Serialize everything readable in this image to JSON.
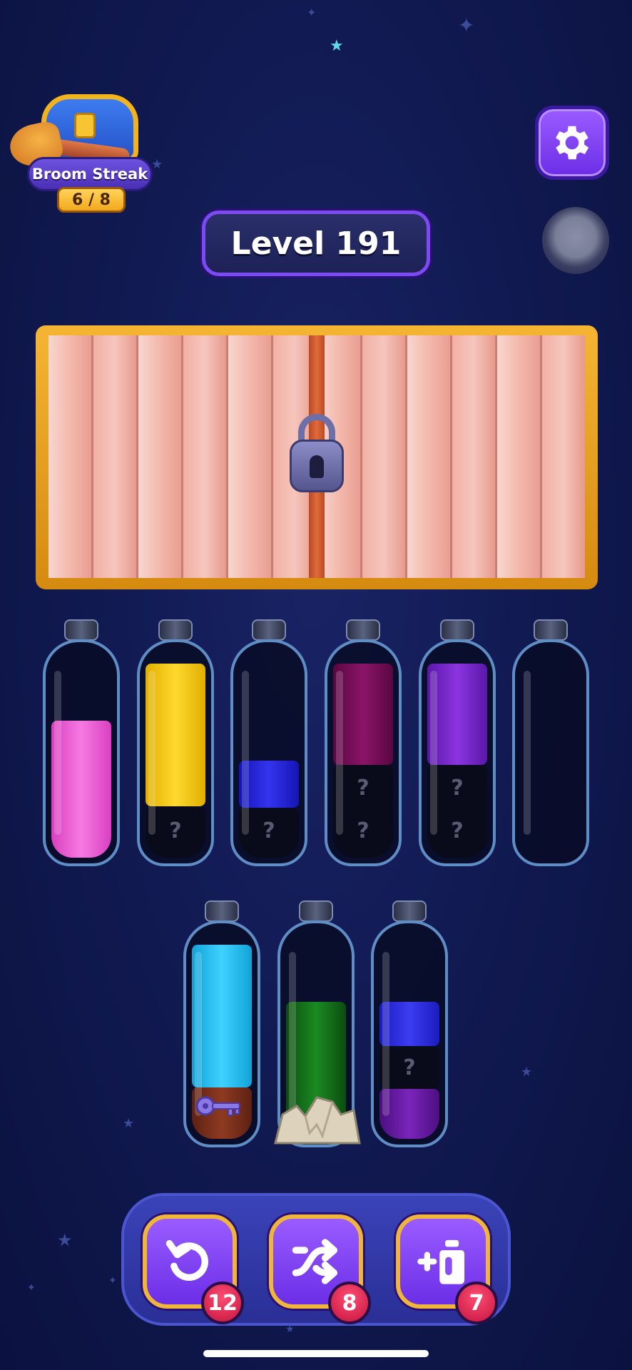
{
  "streak": {
    "label": "Broom Streak",
    "count": "6 / 8"
  },
  "level": {
    "label": "Level 191"
  },
  "locked_box": {
    "state": "locked",
    "icon": "padlock-icon"
  },
  "tubes_row1": [
    {
      "layers": [
        {
          "color": "#f45cd9"
        }
      ]
    },
    {
      "layers": [
        {
          "color": "#f8cc12"
        },
        {
          "hidden": true,
          "mark": "?"
        }
      ]
    },
    {
      "layers": [
        {
          "color": "#2222d8"
        },
        {
          "hidden": true,
          "mark": "?"
        }
      ]
    },
    {
      "layers": [
        {
          "color": "#740a55"
        },
        {
          "hidden": true,
          "mark": "?"
        },
        {
          "hidden": true,
          "mark": "?"
        }
      ]
    },
    {
      "layers": [
        {
          "color": "#7524c8"
        },
        {
          "hidden": true,
          "mark": "?"
        },
        {
          "hidden": true,
          "mark": "?"
        }
      ]
    },
    {
      "layers": []
    }
  ],
  "tubes_row2": [
    {
      "layers": [
        {
          "color": "#22c0ee"
        },
        {
          "color": "#7a2c1e",
          "item": "key-icon"
        }
      ]
    },
    {
      "layers": [
        {
          "color": "#126618"
        }
      ],
      "item": "rock-icon"
    },
    {
      "layers": [
        {
          "color": "#2a2ae0"
        },
        {
          "hidden": true,
          "mark": "?"
        },
        {
          "color": "#6a1a9e"
        }
      ]
    }
  ],
  "toolbar": {
    "undo": {
      "icon": "undo-icon",
      "count": "12"
    },
    "shuffle": {
      "icon": "shuffle-icon",
      "count": "8"
    },
    "add_tube": {
      "icon": "add-tube-icon",
      "count": "7"
    }
  },
  "colors": {
    "button": "#7b3cf0",
    "button_border": "#f0b63a",
    "badge": "#d8194a",
    "frame": "#f0ab28"
  }
}
